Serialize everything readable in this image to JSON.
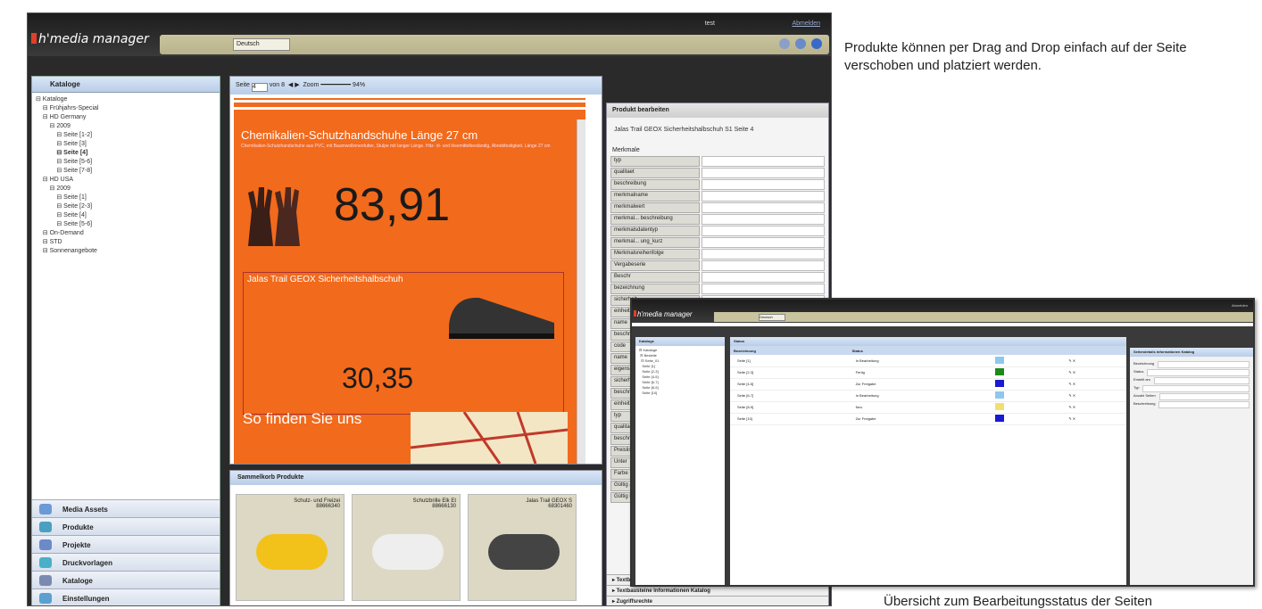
{
  "app": {
    "logo": "h'media manager",
    "user": "test",
    "logout": "Abmelden",
    "language": "Deutsch"
  },
  "left": {
    "header": "Kataloge",
    "tree": [
      {
        "label": "Kataloge",
        "indent": 0
      },
      {
        "label": "Frühjahrs-Special",
        "indent": 1
      },
      {
        "label": "HD Germany",
        "indent": 1
      },
      {
        "label": "2009",
        "indent": 2
      },
      {
        "label": "Seite [1-2]",
        "indent": 3
      },
      {
        "label": "Seite [3]",
        "indent": 3
      },
      {
        "label": "Seite [4]",
        "indent": 3,
        "bold": true
      },
      {
        "label": "Seite [5-6]",
        "indent": 3
      },
      {
        "label": "Seite [7-8]",
        "indent": 3
      },
      {
        "label": "HD USA",
        "indent": 1
      },
      {
        "label": "2009",
        "indent": 2
      },
      {
        "label": "Seite [1]",
        "indent": 3
      },
      {
        "label": "Seite [2-3]",
        "indent": 3
      },
      {
        "label": "Seite [4]",
        "indent": 3
      },
      {
        "label": "Seite [5-6]",
        "indent": 3
      },
      {
        "label": "On-Demand",
        "indent": 1
      },
      {
        "label": "STD",
        "indent": 1
      },
      {
        "label": "Sonnenangebote",
        "indent": 1
      }
    ],
    "nav": [
      "Media Assets",
      "Produkte",
      "Projekte",
      "Druckvorlagen",
      "Kataloge",
      "Einstellungen"
    ]
  },
  "center": {
    "toolbar": {
      "page_label": "Seite",
      "page_value": "4",
      "of": "von 8",
      "zoom": "Zoom",
      "zoom_value": "94%"
    },
    "page": {
      "title": "Chemikalien-Schutzhandschuhe Länge 27 cm",
      "desc": "Chemikalien-Schutzhandschuhe aus PVC, mit Baumwollinnenfutter, Stulpe mit langer Länge. Hitz- öl- und lösemittelbeständig, Abriebfestigkeit. Länge 27 cm",
      "price1": "83,91",
      "shoe_title": "Jalas Trail GEOX Sicherheitshalbschuh",
      "price2": "30,35",
      "find": "So finden Sie uns"
    }
  },
  "basket": {
    "header": "Sammelkorb Produkte",
    "items": [
      {
        "name": "Schutz- und Freizei",
        "code": "88666340"
      },
      {
        "name": "Schutzbrille Elk Et",
        "code": "88666130"
      },
      {
        "name": "Jalas Trail GEOX S",
        "code": "68301460"
      }
    ]
  },
  "right": {
    "header": "Produkt bearbeiten",
    "product": "Jalas Trail GEOX Sicherheitshalbschuh S1 Seite 4",
    "section": "Merkmale",
    "fields": [
      "typ",
      "qualitaet",
      "beschreibung",
      "merkmalname",
      "merkmalwert",
      "merkmal... beschreibung",
      "merkmalsdatentyp",
      "merkmal... ung_kurz",
      "Merkmalsreihenfolge",
      "Vergabeserie",
      "Beschr",
      "bezeichnung",
      "sicherheit",
      "einheit",
      "name",
      "beschr",
      "code",
      "name",
      "eigenschaft",
      "sicherheit",
      "beschr",
      "einheit",
      "typ",
      "qualitaet",
      "beschr",
      "Preisliste",
      "Unter",
      "Farbe",
      "Gültig ab",
      "Gültig bis"
    ],
    "footer": [
      "Textbausteine",
      "Textbausteine Informationen Katalog",
      "Zugriffsrechte"
    ]
  },
  "inset": {
    "header_left": "Kataloge",
    "header_mid": "Status",
    "col1": "Bezeichnung",
    "col2": "Status",
    "rows": [
      {
        "name": "Seite [1]",
        "status": "In Bearbeitung",
        "color": "#8ec8ee"
      },
      {
        "name": "Seite [2-3]",
        "status": "Fertig",
        "color": "#1a8a1a"
      },
      {
        "name": "Seite [4-5]",
        "status": "Zur Freigabe",
        "color": "#1a1ad0"
      },
      {
        "name": "Seite [6-7]",
        "status": "In Bearbeitung",
        "color": "#8ec8ee"
      },
      {
        "name": "Seite [8-9]",
        "status": "Neu",
        "color": "#f0e070"
      },
      {
        "name": "Seite [10]",
        "status": "Zur Freigabe",
        "color": "#1a1ad0"
      }
    ],
    "right_header": "Seitendetails Informationen Katalog",
    "right_fields": [
      "Bezeichnung",
      "Status",
      "Erstellt am",
      "Typ",
      "Anzahl Seiten",
      "Beschreibung"
    ]
  },
  "captions": {
    "top": "Produkte können per Drag and Drop einfach auf der Seite verschoben und platziert werden.",
    "bottom": "Übersicht zum Bearbeitungsstatus der Seiten"
  }
}
